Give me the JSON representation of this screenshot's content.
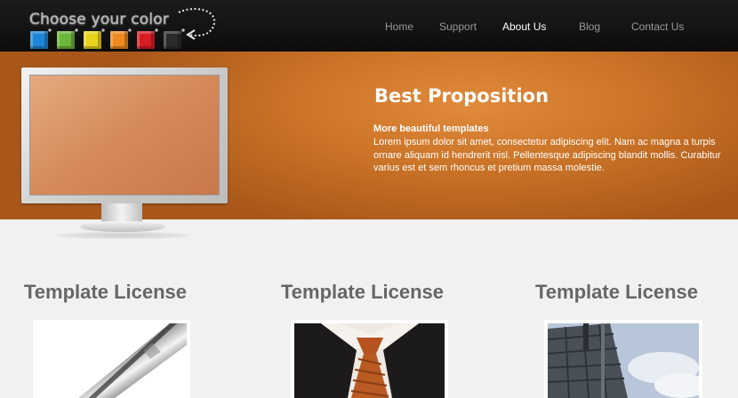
{
  "logo": {
    "text": "Choose your color",
    "cubes": [
      "#1e86d6",
      "#6cb63a",
      "#e8d21c",
      "#ee8a1e",
      "#d81c24",
      "#2a2a2a"
    ]
  },
  "nav": {
    "items": [
      {
        "label": "Home"
      },
      {
        "label": "Support"
      },
      {
        "label": "About Us"
      },
      {
        "label": "Blog"
      },
      {
        "label": "Contact Us"
      }
    ],
    "active": "About Us"
  },
  "banner": {
    "title": "Best Proposition",
    "subtitle": "More beautiful templates",
    "body": "Lorem ipsum dolor sit amet, consectetur adipiscing elit. Nam ac magna a turpis ornare aliquam id hendrerit nisl. Pellentesque adipiscing blandit mollis. Curabitur varius est et sem rhoncus et pretium massa molestie."
  },
  "columns": [
    {
      "title": "Template License",
      "image": "pen-closeup-image"
    },
    {
      "title": "Template License",
      "image": "businessman-tie-image"
    },
    {
      "title": "Template License",
      "image": "building-sky-image"
    }
  ]
}
